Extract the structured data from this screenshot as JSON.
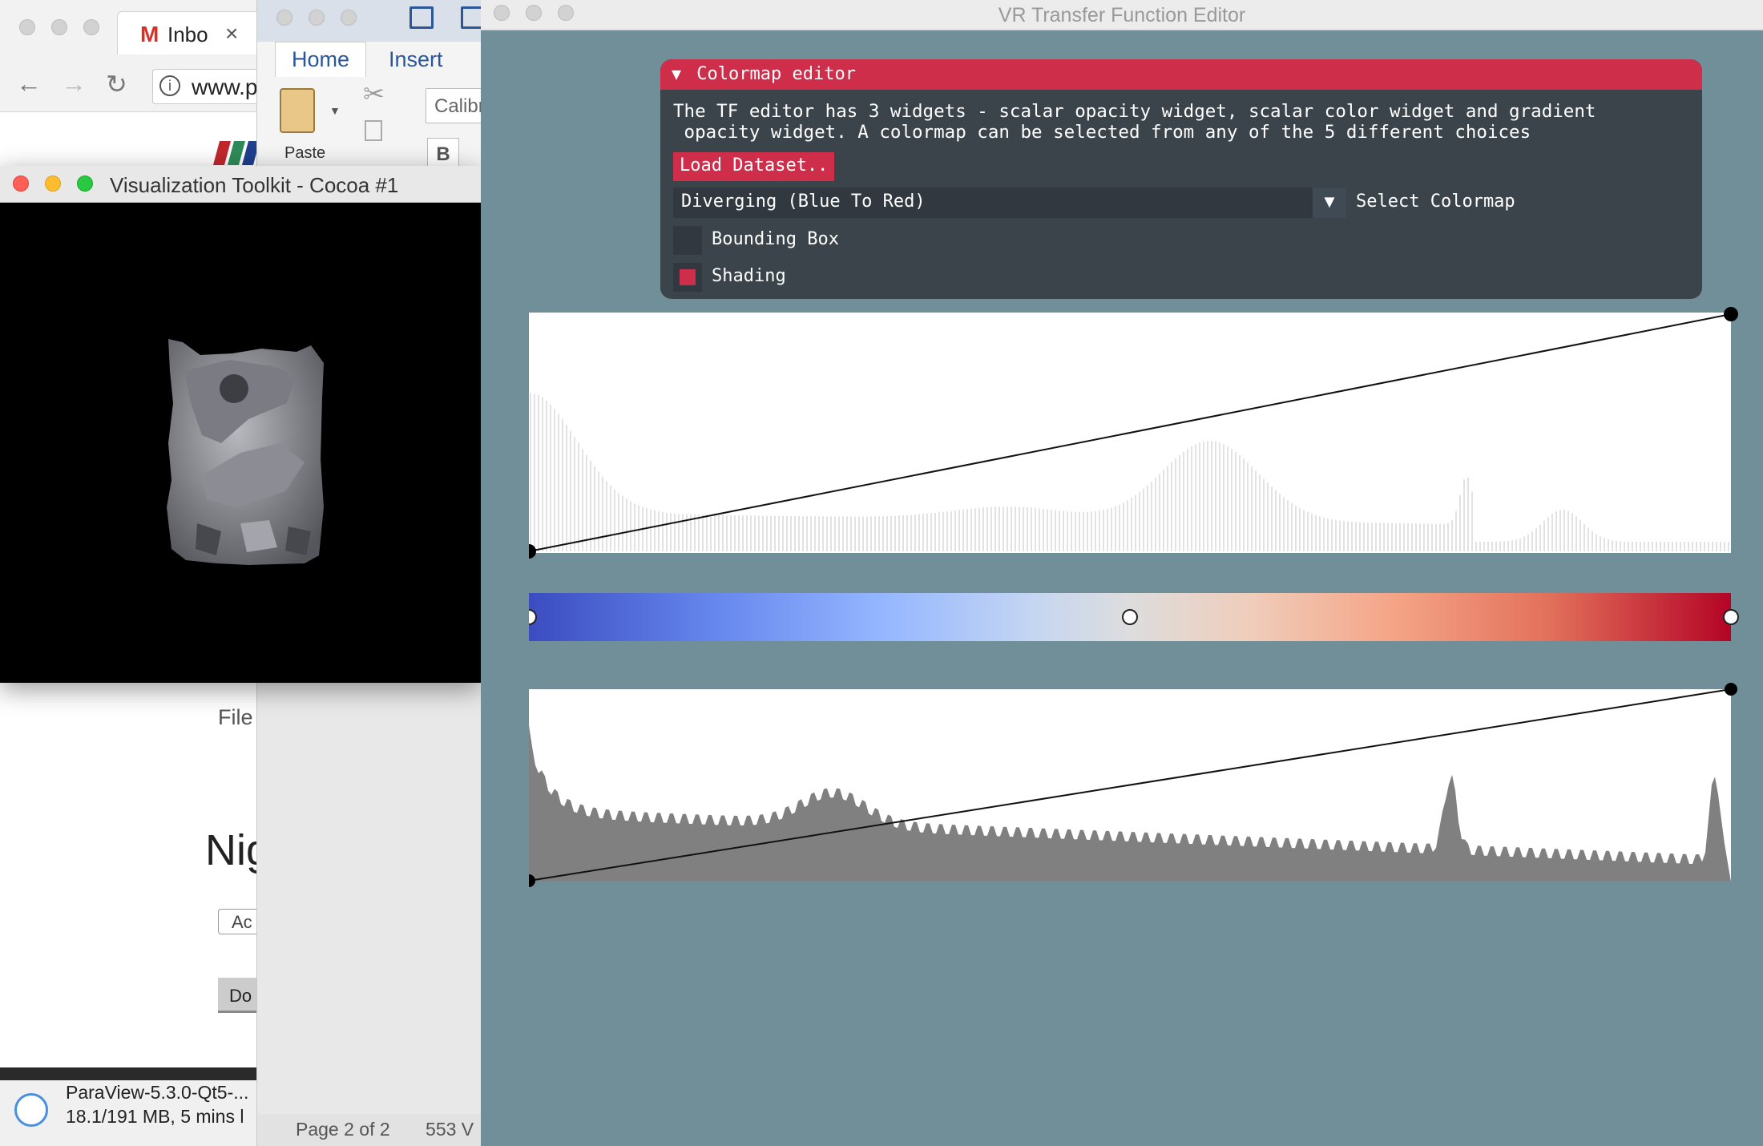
{
  "browser": {
    "tab_title": "Inbo",
    "tab_close": "×",
    "address": "www.p",
    "page_texts": [
      "File",
      "Nig",
      "Ac",
      "Do"
    ],
    "download": {
      "name": "ParaView-5.3.0-Qt5-...",
      "progress": "18.1/191 MB, 5 mins l"
    }
  },
  "word": {
    "tabs": [
      "Home",
      "Insert"
    ],
    "paste_label": "Paste",
    "font_box": "Calibr",
    "bold_label": "B",
    "status_page": "Page 2 of 2",
    "status_words": "553 V"
  },
  "vtk": {
    "title": "Visualization Toolkit - Cocoa #1"
  },
  "editor": {
    "title": "VR Transfer Function Editor",
    "panel": {
      "header": "Colormap editor",
      "desc": "The TF editor has 3 widgets - scalar opacity widget, scalar color widget and gradient\n opacity widget. A colormap can be selected from any of the 5 different choices",
      "load_button": "Load Dataset..",
      "colormap_selected": "Diverging (Blue To Red)",
      "colormap_label": "Select Colormap",
      "bounding_box_label": "Bounding Box",
      "bounding_box_checked": false,
      "shading_label": "Shading",
      "shading_checked": true
    },
    "colors": {
      "accent": "#cf2e4b",
      "background": "#708f99",
      "panel": "#3b434b",
      "ctf_low": "#3b4cc0",
      "ctf_mid": "#dddddd",
      "ctf_high": "#b40426"
    }
  }
}
